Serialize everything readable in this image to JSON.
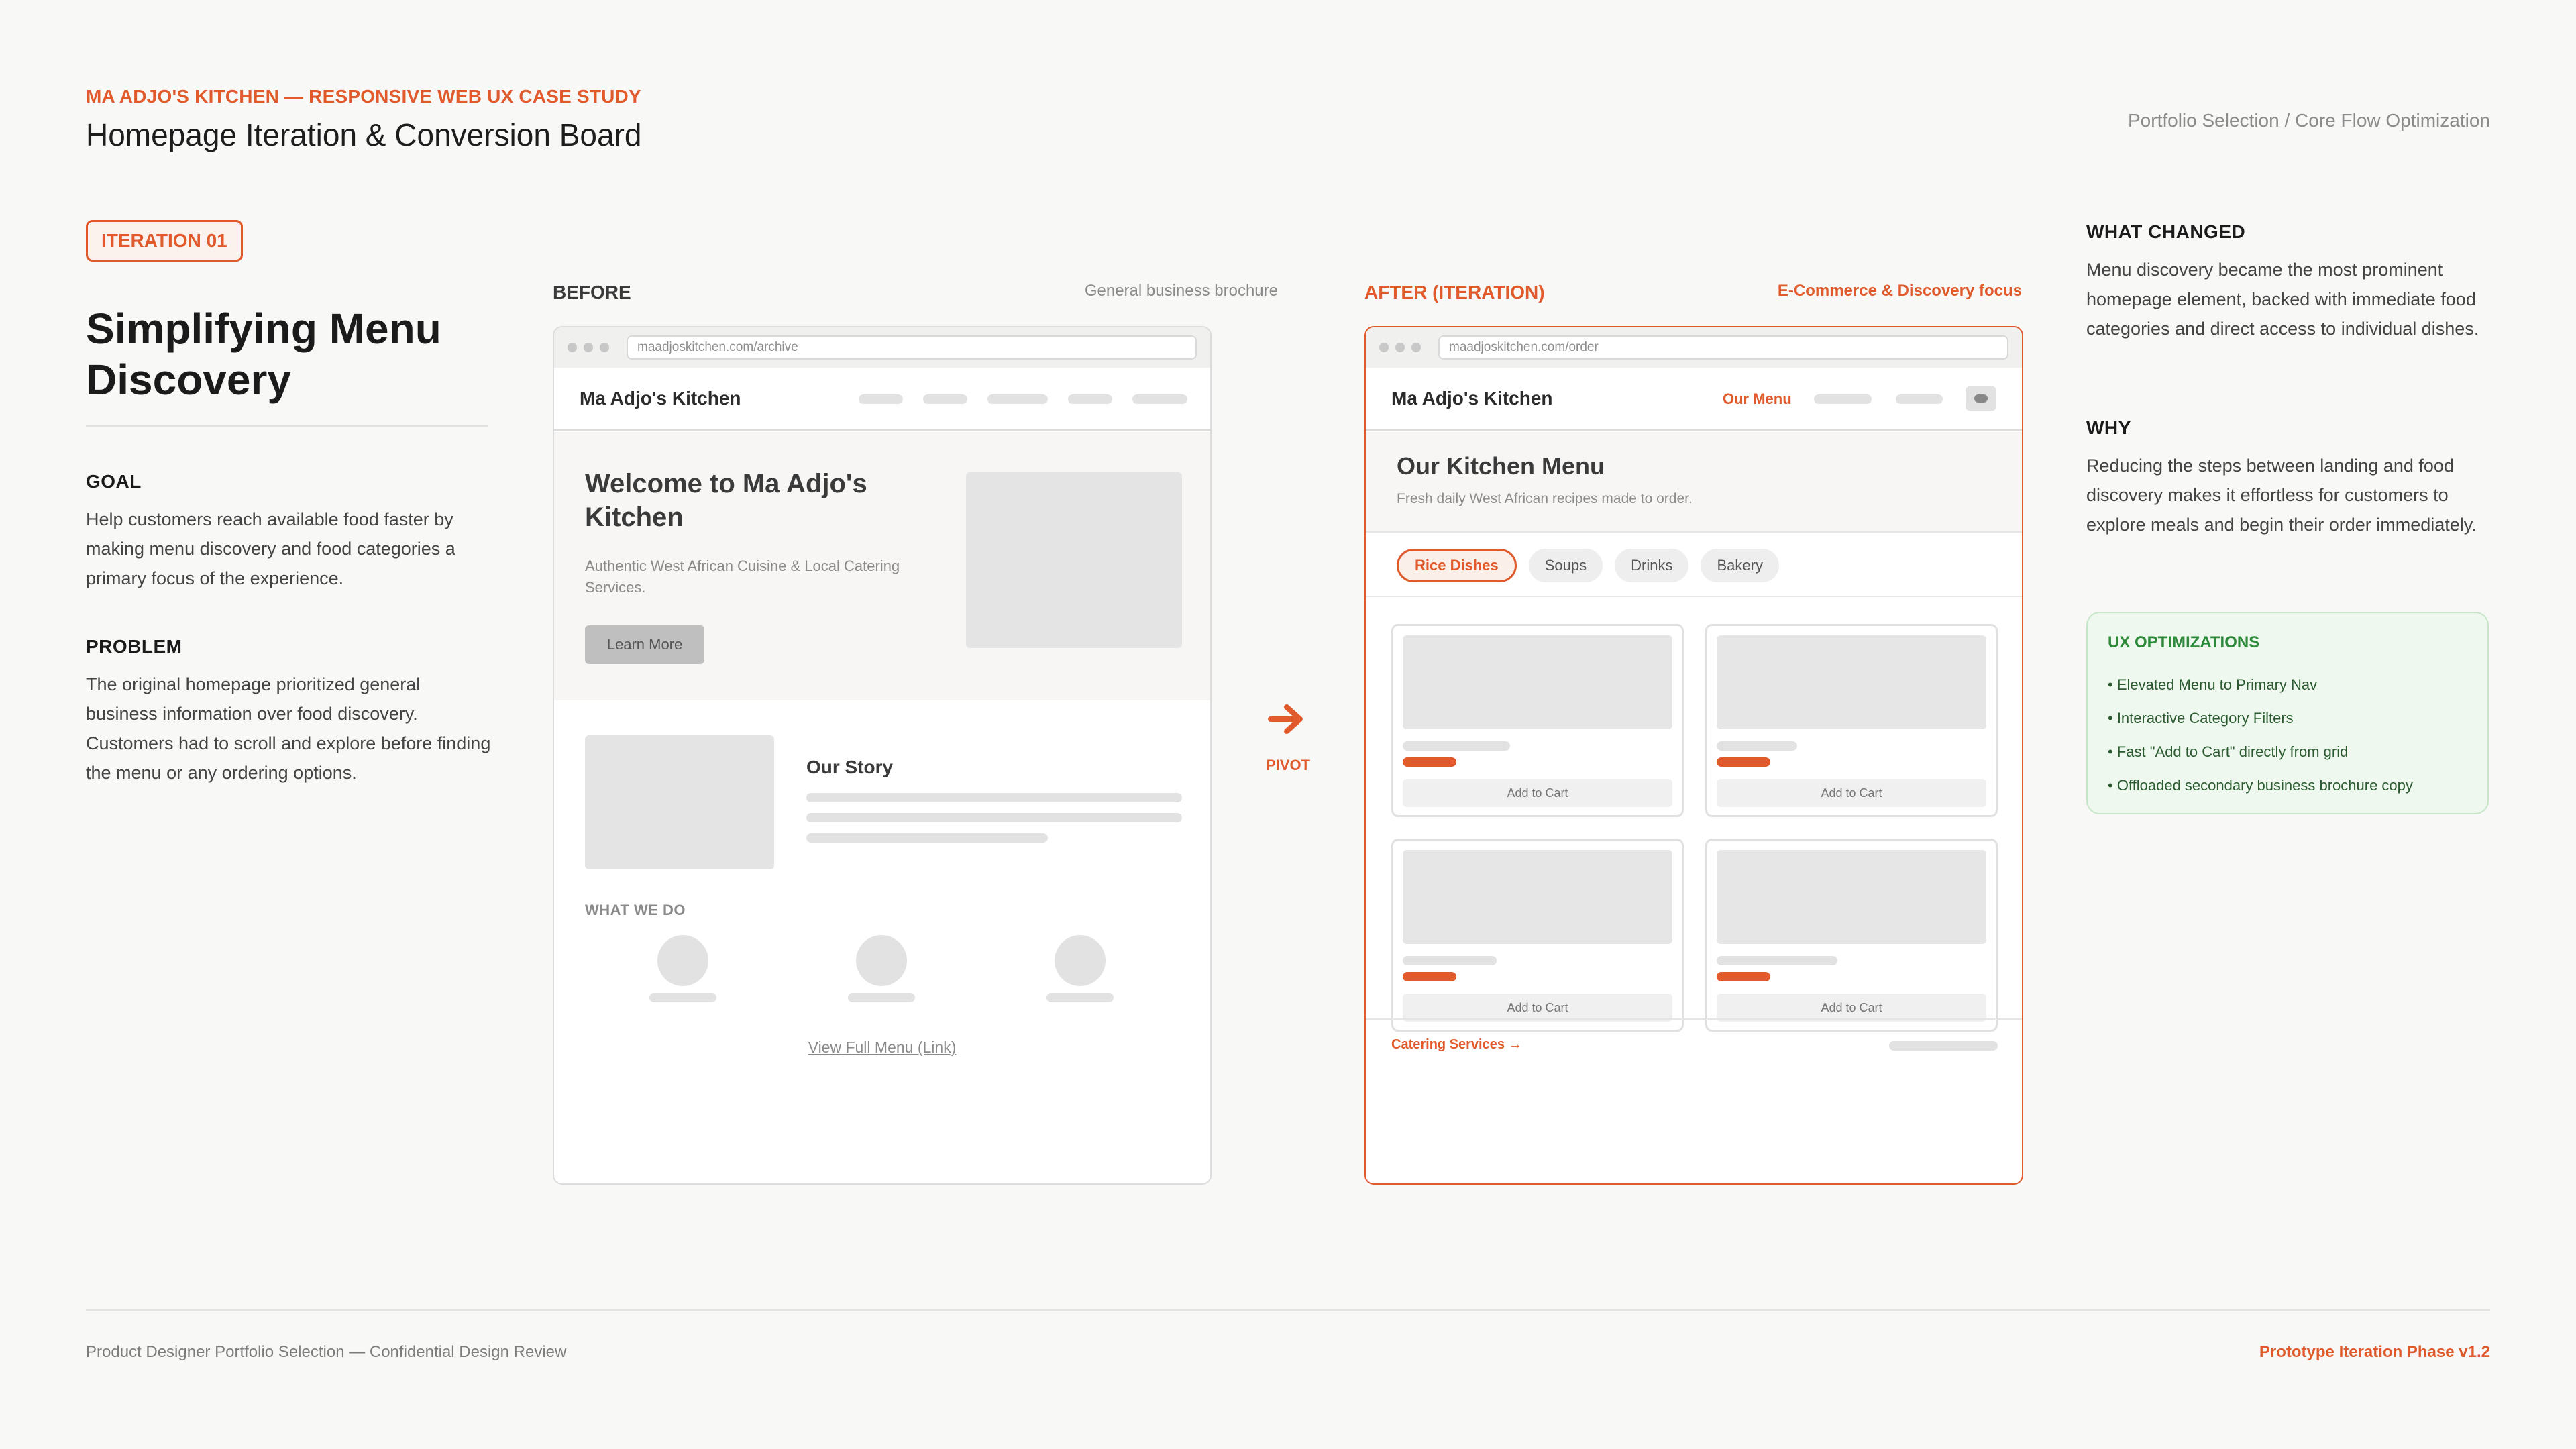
{
  "header": {
    "kicker": "MA ADJO'S KITCHEN  —  RESPONSIVE WEB UX CASE STUDY",
    "title": "Homepage Iteration & Conversion Board",
    "meta": "Portfolio Selection / Core Flow Optimization"
  },
  "left": {
    "badge": "ITERATION 01",
    "title": "Simplifying Menu Discovery",
    "goal_label": "GOAL",
    "goal_text": "Help customers reach available food faster by making menu discovery and food categories a primary focus of the experience.",
    "problem_label": "PROBLEM",
    "problem_text": "The original homepage prioritized general business information over food discovery. Customers had to scroll and explore before finding the menu or any ordering options."
  },
  "before": {
    "label": "BEFORE",
    "caption": "General business brochure",
    "url": "maadjoskitchen.com/archive",
    "brand": "Ma Adjo's Kitchen",
    "hero_title": "Welcome to Ma Adjo's Kitchen",
    "hero_sub": "Authentic West African Cuisine & Local Catering Services.",
    "hero_button": "Learn More",
    "story_title": "Our Story",
    "what_we_do": "WHAT WE DO",
    "view_link": "View Full Menu (Link)"
  },
  "pivot": {
    "label": "PIVOT",
    "icon": "arrow-right-icon",
    "color": "#e05a2b"
  },
  "after": {
    "label": "AFTER (ITERATION)",
    "caption": "E-Commerce & Discovery focus",
    "url": "maadjoskitchen.com/order",
    "brand": "Ma Adjo's Kitchen",
    "nav_active": "Our Menu",
    "menu_title": "Our Kitchen Menu",
    "menu_sub": "Fresh daily West African recipes made to order.",
    "filters": [
      "Rice Dishes",
      "Soups",
      "Drinks",
      "Bakery"
    ],
    "active_filter": "Rice Dishes",
    "cards": [
      {
        "cta": "Add to Cart"
      },
      {
        "cta": "Add to Cart"
      },
      {
        "cta": "Add to Cart"
      },
      {
        "cta": "Add to Cart"
      }
    ],
    "catering_link": "Catering Services →"
  },
  "right": {
    "changed_label": "WHAT CHANGED",
    "changed_text": "Menu discovery became the most prominent homepage element, backed with immediate food categories and direct access to individual dishes.",
    "why_label": "WHY",
    "why_text": "Reducing the steps between landing and food discovery makes it effortless for customers to explore meals and begin their order immediately.",
    "ux_title": "UX OPTIMIZATIONS",
    "ux_items": [
      "• Elevated Menu to Primary Nav",
      "• Interactive Category Filters",
      "• Fast \"Add to Cart\" directly from grid",
      "• Offloaded secondary business brochure copy"
    ]
  },
  "footer": {
    "left": "Product Designer Portfolio Selection  —  Confidential Design Review",
    "right": "Prototype Iteration Phase v1.2"
  },
  "colors": {
    "accent": "#e05a2b",
    "success": "#2d8a3a",
    "background": "#f8f8f7"
  }
}
